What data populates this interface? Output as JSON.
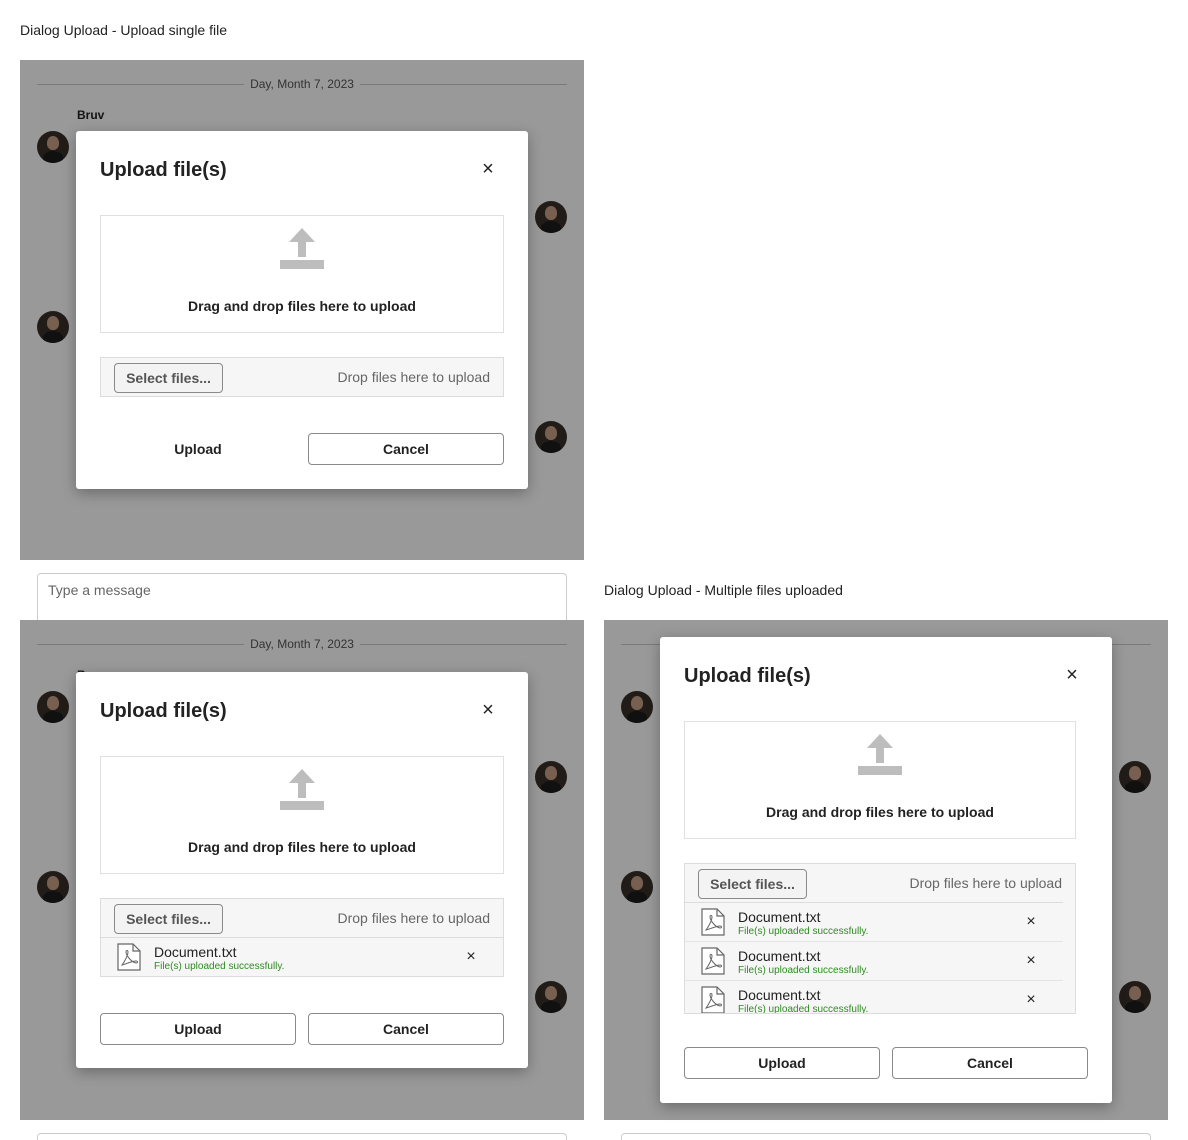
{
  "captions": {
    "single": "Dialog Upload - Upload single file",
    "multiple": "Dialog Upload - Multiple files uploaded"
  },
  "chat": {
    "date": "Day, Month 7, 2023",
    "sender": "Bruv",
    "composer_placeholder": "Type a message"
  },
  "dialog": {
    "title": "Upload file(s)",
    "close_icon": "×",
    "dropzone_text": "Drag and drop files here to upload",
    "select_label": "Select files...",
    "drop_hint": "Drop files here to upload",
    "upload_label": "Upload",
    "cancel_label": "Cancel",
    "remove_icon": "×"
  },
  "files_single": [
    {
      "name": "Document.txt",
      "status": "File(s) uploaded successfully."
    }
  ],
  "files_multiple": [
    {
      "name": "Document.txt",
      "status": "File(s) uploaded successfully."
    },
    {
      "name": "Document.txt",
      "status": "File(s) uploaded successfully."
    },
    {
      "name": "Document.txt",
      "status": "File(s) uploaded successfully."
    }
  ],
  "colors": {
    "success": "#2e8b21",
    "overlay": "rgba(0,0,0,0.4)"
  }
}
